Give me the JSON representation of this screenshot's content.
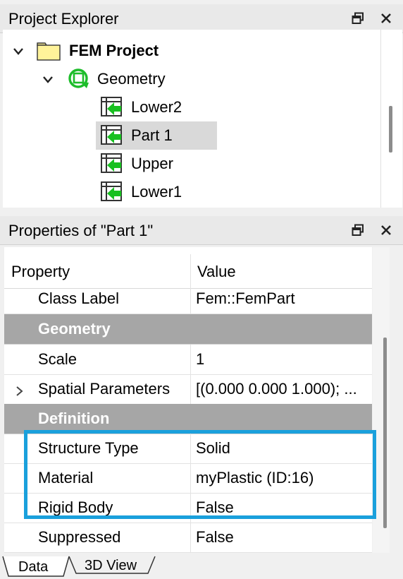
{
  "project_explorer": {
    "title": "Project Explorer",
    "tree": {
      "root": "FEM Project",
      "geometry": "Geometry",
      "parts": [
        "Lower2",
        "Part 1",
        "Upper",
        "Lower1"
      ],
      "selected": "Part 1"
    }
  },
  "properties": {
    "title": "Properties of \"Part 1\"",
    "header": {
      "property": "Property",
      "value": "Value"
    },
    "class_label": {
      "name": "Class Label",
      "value": "Fem::FemPart"
    },
    "group_geometry": "Geometry",
    "scale": {
      "name": "Scale",
      "value": "1"
    },
    "spatial": {
      "name": "Spatial Parameters",
      "value": "[(0.000 0.000 1.000); ..."
    },
    "group_definition": "Definition",
    "structure_type": {
      "name": "Structure Type",
      "value": "Solid"
    },
    "material": {
      "name": "Material",
      "value": "myPlastic (ID:16)"
    },
    "rigid_body": {
      "name": "Rigid Body",
      "value": "False"
    },
    "suppressed": {
      "name": "Suppressed",
      "value": "False"
    }
  },
  "tabs": [
    "Data",
    "3D View"
  ],
  "highlight_color": "#1aa0dc"
}
